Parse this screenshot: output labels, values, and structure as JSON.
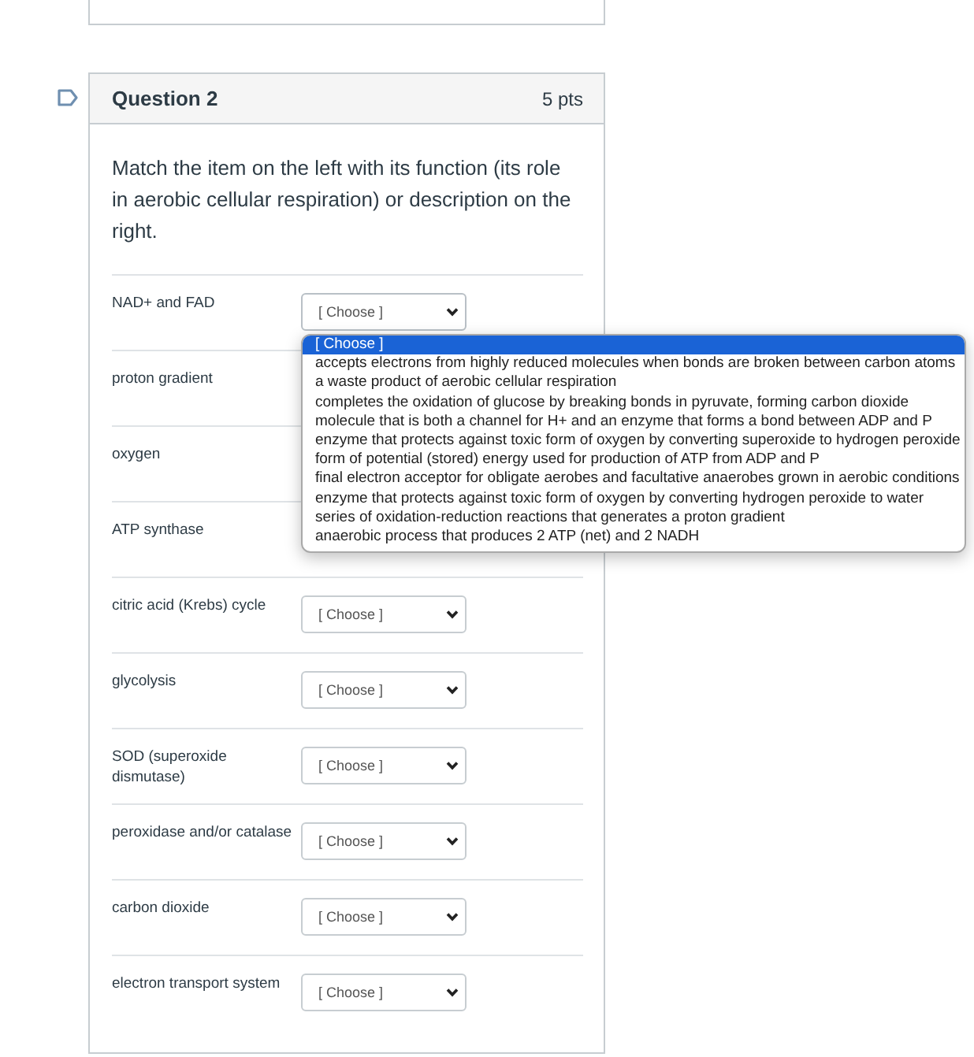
{
  "question": {
    "title": "Question 2",
    "points": "5 pts",
    "prompt": "Match the item on the left with its function (its role in aerobic cellular respiration) or description on the right.",
    "matches": [
      {
        "label": "NAD+ and FAD",
        "answer": {
          "value": "[ Choose ]",
          "expanded": true,
          "options": [
            {
              "text": "[ Choose ]",
              "selected": true
            },
            {
              "text": "accepts electrons from highly reduced molecules when bonds are broken between carbon atoms",
              "selected": false
            },
            {
              "text": "a waste product of aerobic cellular respiration",
              "selected": false
            },
            {
              "text": "completes the oxidation of glucose by breaking bonds in pyruvate, forming carbon dioxide",
              "selected": false
            },
            {
              "text": "molecule that is both a channel for H+ and an enzyme that forms a bond between ADP and P",
              "selected": false
            },
            {
              "text": "enzyme that protects against toxic form of oxygen by converting superoxide to hydrogen peroxide",
              "selected": false
            },
            {
              "text": "form of potential (stored) energy used for production of ATP from ADP and P",
              "selected": false
            },
            {
              "text": "final electron acceptor for obligate aerobes and facultative anaerobes grown in aerobic conditions",
              "selected": false
            },
            {
              "text": "enzyme that protects against toxic form of oxygen by converting hydrogen peroxide to water",
              "selected": false
            },
            {
              "text": "series of oxidation-reduction reactions that generates a proton gradient",
              "selected": false
            },
            {
              "text": "anaerobic process that produces 2 ATP (net) and 2 NADH",
              "selected": false
            }
          ]
        }
      },
      {
        "label": "proton gradient"
      },
      {
        "label": "oxygen"
      },
      {
        "label": "ATP synthase"
      },
      {
        "label": "citric acid (Krebs) cycle",
        "answer": {
          "value": "[ Choose ]",
          "expanded": false
        }
      },
      {
        "label": "glycolysis",
        "answer": {
          "value": "[ Choose ]",
          "expanded": false
        }
      },
      {
        "label": "SOD (superoxide dismutase)",
        "answer": {
          "value": "[ Choose ]",
          "expanded": false
        }
      },
      {
        "label": "peroxidase and/or catalase",
        "answer": {
          "value": "[ Choose ]",
          "expanded": false
        }
      },
      {
        "label": "carbon dioxide",
        "answer": {
          "value": "[ Choose ]",
          "expanded": false
        }
      },
      {
        "label": "electron transport system",
        "answer": {
          "value": "[ Choose ]",
          "expanded": false
        }
      }
    ]
  }
}
